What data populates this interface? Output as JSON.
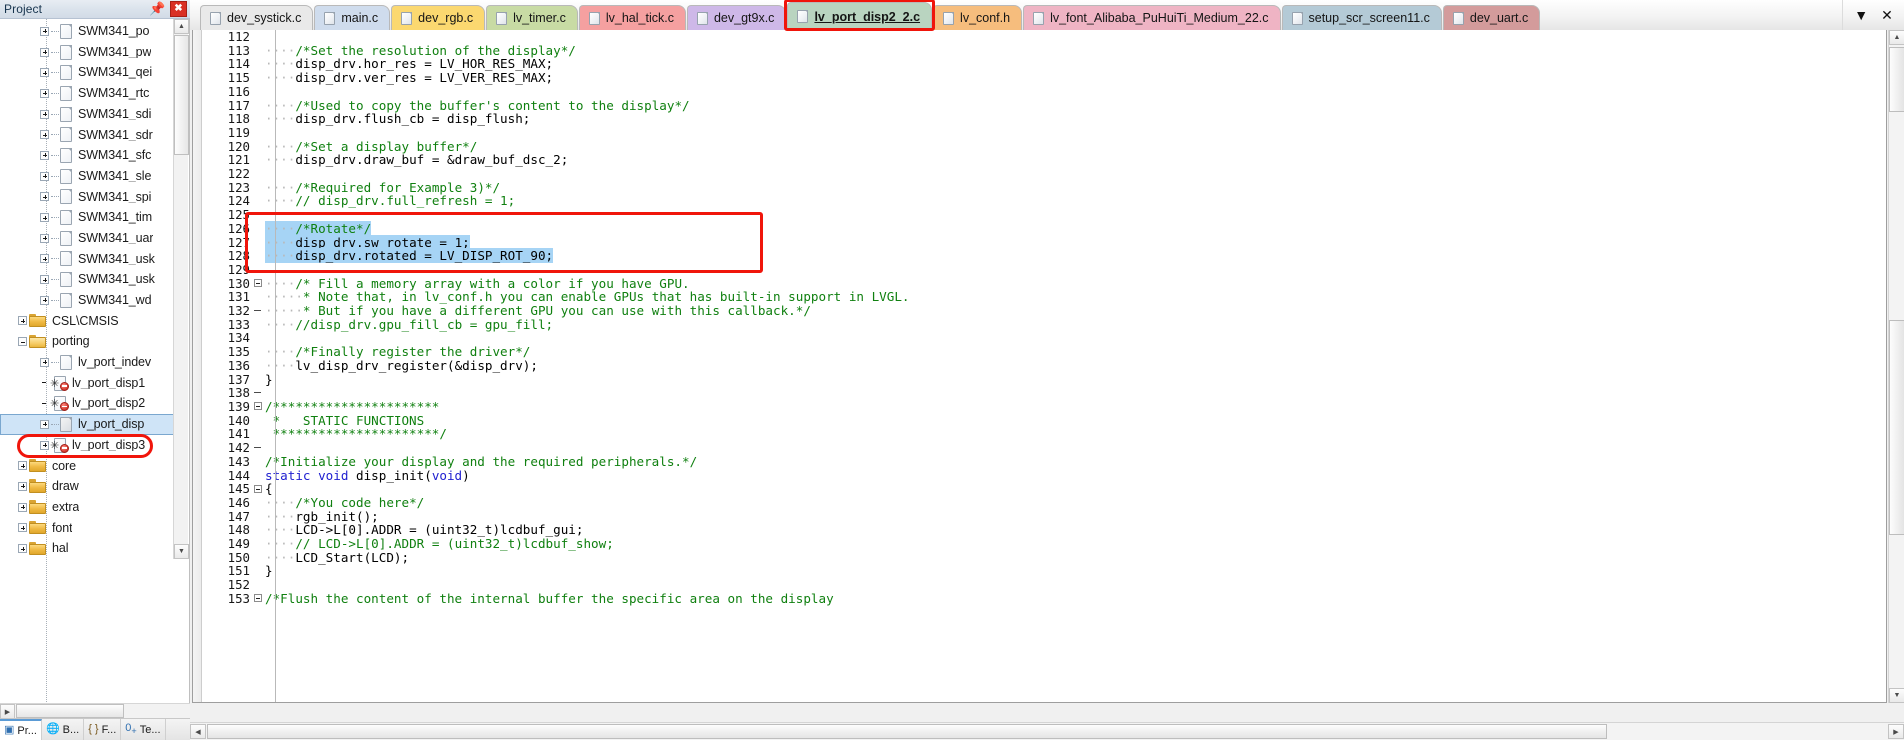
{
  "project_panel": {
    "title": "Project",
    "pin_icon": "pin-icon",
    "close_icon": "close-icon",
    "tree": [
      {
        "label": "SWM341_po",
        "icon": "file-icon",
        "indent": 3,
        "expander": "plus"
      },
      {
        "label": "SWM341_pw",
        "icon": "file-icon",
        "indent": 3,
        "expander": "plus"
      },
      {
        "label": "SWM341_qei",
        "icon": "file-icon",
        "indent": 3,
        "expander": "plus"
      },
      {
        "label": "SWM341_rtc",
        "icon": "file-icon",
        "indent": 3,
        "expander": "plus"
      },
      {
        "label": "SWM341_sdi",
        "icon": "file-icon",
        "indent": 3,
        "expander": "plus"
      },
      {
        "label": "SWM341_sdr",
        "icon": "file-icon",
        "indent": 3,
        "expander": "plus"
      },
      {
        "label": "SWM341_sfc",
        "icon": "file-icon",
        "indent": 3,
        "expander": "plus"
      },
      {
        "label": "SWM341_sle",
        "icon": "file-icon",
        "indent": 3,
        "expander": "plus"
      },
      {
        "label": "SWM341_spi",
        "icon": "file-icon",
        "indent": 3,
        "expander": "plus"
      },
      {
        "label": "SWM341_tim",
        "icon": "file-icon",
        "indent": 3,
        "expander": "plus"
      },
      {
        "label": "SWM341_uar",
        "icon": "file-icon",
        "indent": 3,
        "expander": "plus"
      },
      {
        "label": "SWM341_usk",
        "icon": "file-icon",
        "indent": 3,
        "expander": "plus"
      },
      {
        "label": "SWM341_usk",
        "icon": "file-icon",
        "indent": 3,
        "expander": "plus"
      },
      {
        "label": "SWM341_wd",
        "icon": "file-icon",
        "indent": 3,
        "expander": "plus"
      },
      {
        "label": "CSL\\CMSIS",
        "icon": "folder-icon",
        "indent": 2,
        "expander": "plus"
      },
      {
        "label": "porting",
        "icon": "folder-open-icon",
        "indent": 2,
        "expander": "minus"
      },
      {
        "label": "lv_port_indev",
        "icon": "file-icon",
        "indent": 3,
        "expander": "plus"
      },
      {
        "label": "lv_port_disp1",
        "icon": "file-excluded-icon",
        "indent": 3,
        "expander": "none"
      },
      {
        "label": "lv_port_disp2",
        "icon": "file-excluded-icon",
        "indent": 3,
        "expander": "none"
      },
      {
        "label": "lv_port_disp",
        "icon": "file-icon",
        "indent": 3,
        "expander": "plus",
        "selected": true
      },
      {
        "label": "lv_port_disp3",
        "icon": "file-excluded-icon",
        "indent": 3,
        "expander": "plus"
      },
      {
        "label": "core",
        "icon": "folder-icon",
        "indent": 2,
        "expander": "plus"
      },
      {
        "label": "draw",
        "icon": "folder-icon",
        "indent": 2,
        "expander": "plus"
      },
      {
        "label": "extra",
        "icon": "folder-icon",
        "indent": 2,
        "expander": "plus"
      },
      {
        "label": "font",
        "icon": "folder-icon",
        "indent": 2,
        "expander": "plus"
      },
      {
        "label": "hal",
        "icon": "folder-icon",
        "indent": 2,
        "expander": "plus"
      }
    ],
    "bottom_tabs": [
      {
        "label": "Pr...",
        "icon": "project-icon",
        "active": true
      },
      {
        "label": "B...",
        "icon": "books-icon",
        "active": false
      },
      {
        "label": "F...",
        "icon": "functions-icon",
        "active": false
      },
      {
        "label": "Te...",
        "icon": "templates-icon",
        "active": false
      }
    ]
  },
  "editor": {
    "tabs": [
      {
        "label": "dev_systick.c",
        "color": "#e9e9e9",
        "active": false
      },
      {
        "label": "main.c",
        "color": "#cfdced",
        "active": false
      },
      {
        "label": "dev_rgb.c",
        "color": "#fbd870",
        "active": false
      },
      {
        "label": "lv_timer.c",
        "color": "#c8dba4",
        "active": false
      },
      {
        "label": "lv_hal_tick.c",
        "color": "#f5a0a0",
        "active": false
      },
      {
        "label": "dev_gt9x.c",
        "color": "#ceb8e8",
        "active": false
      },
      {
        "label": "lv_port_disp2_2.c",
        "color": "#b9d4c0",
        "active": true
      },
      {
        "label": "lv_conf.h",
        "color": "#f6bd7d",
        "active": false
      },
      {
        "label": "lv_font_Alibaba_PuHuiTi_Medium_22.c",
        "color": "#efb4c4",
        "active": false
      },
      {
        "label": "setup_scr_screen11.c",
        "color": "#b4cad6",
        "active": false
      },
      {
        "label": "dev_uart.c",
        "color": "#d39b9b",
        "active": false
      }
    ],
    "tab_overflow_icon": "chevron-down-icon",
    "tab_close_icon": "close-icon",
    "annotation_color": "#f0150b",
    "selection_color": "#a6d4f5",
    "lines": [
      {
        "n": 112,
        "fold": "",
        "tokens": []
      },
      {
        "n": 113,
        "fold": "",
        "tokens": [
          {
            "t": "····",
            "c": "ws"
          },
          {
            "t": "/*Set the resolution of the display*/",
            "c": "cmt"
          }
        ]
      },
      {
        "n": 114,
        "fold": "",
        "tokens": [
          {
            "t": "····",
            "c": "ws"
          },
          {
            "t": "disp_drv.hor_res = LV_HOR_RES_MAX;",
            "c": "pln"
          }
        ]
      },
      {
        "n": 115,
        "fold": "",
        "tokens": [
          {
            "t": "····",
            "c": "ws"
          },
          {
            "t": "disp_drv.ver_res = LV_VER_RES_MAX;",
            "c": "pln"
          }
        ]
      },
      {
        "n": 116,
        "fold": "",
        "tokens": []
      },
      {
        "n": 117,
        "fold": "",
        "tokens": [
          {
            "t": "····",
            "c": "ws"
          },
          {
            "t": "/*Used to copy the buffer's content to the display*/",
            "c": "cmt"
          }
        ]
      },
      {
        "n": 118,
        "fold": "",
        "tokens": [
          {
            "t": "····",
            "c": "ws"
          },
          {
            "t": "disp_drv.flush_cb = disp_flush;",
            "c": "pln"
          }
        ]
      },
      {
        "n": 119,
        "fold": "",
        "tokens": []
      },
      {
        "n": 120,
        "fold": "",
        "tokens": [
          {
            "t": "····",
            "c": "ws"
          },
          {
            "t": "/*Set a display buffer*/",
            "c": "cmt"
          }
        ]
      },
      {
        "n": 121,
        "fold": "",
        "tokens": [
          {
            "t": "····",
            "c": "ws"
          },
          {
            "t": "disp_drv.draw_buf = &draw_buf_dsc_2;",
            "c": "pln"
          }
        ]
      },
      {
        "n": 122,
        "fold": "",
        "tokens": []
      },
      {
        "n": 123,
        "fold": "",
        "tokens": [
          {
            "t": "····",
            "c": "ws"
          },
          {
            "t": "/*Required for Example 3)*/",
            "c": "cmt"
          }
        ]
      },
      {
        "n": 124,
        "fold": "",
        "tokens": [
          {
            "t": "····",
            "c": "ws"
          },
          {
            "t": "// disp_drv.full_refresh = 1;",
            "c": "cmt"
          }
        ]
      },
      {
        "n": 125,
        "fold": "",
        "tokens": []
      },
      {
        "n": 126,
        "fold": "",
        "sel": true,
        "tokens": [
          {
            "t": "····",
            "c": "ws sel"
          },
          {
            "t": "/*Rotate*/",
            "c": "cmt sel"
          }
        ]
      },
      {
        "n": 127,
        "fold": "",
        "sel": true,
        "tokens": [
          {
            "t": "····",
            "c": "ws sel"
          },
          {
            "t": "disp_drv.sw_rotate = 1;",
            "c": "pln sel"
          }
        ]
      },
      {
        "n": 128,
        "fold": "",
        "sel": true,
        "tokens": [
          {
            "t": "····",
            "c": "ws sel"
          },
          {
            "t": "disp_drv.rotated = LV_DISP_ROT_90;",
            "c": "pln sel"
          }
        ]
      },
      {
        "n": 129,
        "fold": "",
        "tokens": []
      },
      {
        "n": 130,
        "fold": "box",
        "tokens": [
          {
            "t": "····",
            "c": "ws"
          },
          {
            "t": "/* Fill a memory array with a color if you have GPU.",
            "c": "cmt"
          }
        ]
      },
      {
        "n": 131,
        "fold": "",
        "tokens": [
          {
            "t": "·····",
            "c": "ws"
          },
          {
            "t": "* Note that, in lv_conf.h you can enable GPUs that has built-in support in LVGL.",
            "c": "cmt"
          }
        ]
      },
      {
        "n": 132,
        "fold": "bar",
        "tokens": [
          {
            "t": "·····",
            "c": "ws"
          },
          {
            "t": "* But if you have a different GPU you can use with this callback.*/",
            "c": "cmt"
          }
        ]
      },
      {
        "n": 133,
        "fold": "",
        "tokens": [
          {
            "t": "····",
            "c": "ws"
          },
          {
            "t": "//disp_drv.gpu_fill_cb = gpu_fill;",
            "c": "cmt"
          }
        ]
      },
      {
        "n": 134,
        "fold": "",
        "tokens": []
      },
      {
        "n": 135,
        "fold": "",
        "tokens": [
          {
            "t": "····",
            "c": "ws"
          },
          {
            "t": "/*Finally register the driver*/",
            "c": "cmt"
          }
        ]
      },
      {
        "n": 136,
        "fold": "",
        "tokens": [
          {
            "t": "····",
            "c": "ws"
          },
          {
            "t": "lv_disp_drv_register(&disp_drv);",
            "c": "pln"
          }
        ]
      },
      {
        "n": 137,
        "fold": "",
        "tokens": [
          {
            "t": "}",
            "c": "pln"
          }
        ]
      },
      {
        "n": 138,
        "fold": "bar",
        "tokens": []
      },
      {
        "n": 139,
        "fold": "box",
        "tokens": [
          {
            "t": "/**********************",
            "c": "cmt"
          }
        ]
      },
      {
        "n": 140,
        "fold": "",
        "tokens": [
          {
            "t": " *   STATIC FUNCTIONS",
            "c": "cmt"
          }
        ]
      },
      {
        "n": 141,
        "fold": "",
        "tokens": [
          {
            "t": " **********************/",
            "c": "cmt"
          }
        ]
      },
      {
        "n": 142,
        "fold": "bar",
        "tokens": []
      },
      {
        "n": 143,
        "fold": "",
        "tokens": [
          {
            "t": "/*Initialize your display and the required peripherals.*/",
            "c": "cmt"
          }
        ]
      },
      {
        "n": 144,
        "fold": "",
        "tokens": [
          {
            "t": "static void",
            "c": "kw"
          },
          {
            "t": " disp_init(",
            "c": "pln"
          },
          {
            "t": "void",
            "c": "kw"
          },
          {
            "t": ")",
            "c": "pln"
          }
        ]
      },
      {
        "n": 145,
        "fold": "box",
        "tokens": [
          {
            "t": "{",
            "c": "pln"
          }
        ]
      },
      {
        "n": 146,
        "fold": "",
        "tokens": [
          {
            "t": "····",
            "c": "ws"
          },
          {
            "t": "/*You code here*/",
            "c": "cmt"
          }
        ]
      },
      {
        "n": 147,
        "fold": "",
        "tokens": [
          {
            "t": "····",
            "c": "ws"
          },
          {
            "t": "rgb_init();",
            "c": "pln"
          }
        ]
      },
      {
        "n": 148,
        "fold": "",
        "tokens": [
          {
            "t": "····",
            "c": "ws"
          },
          {
            "t": "LCD->L[0].ADDR = (uint32_t)lcdbuf_gui;",
            "c": "pln"
          }
        ]
      },
      {
        "n": 149,
        "fold": "",
        "tokens": [
          {
            "t": "····",
            "c": "ws"
          },
          {
            "t": "// LCD->L[0].ADDR = (uint32_t)lcdbuf_show;",
            "c": "cmt"
          }
        ]
      },
      {
        "n": 150,
        "fold": "",
        "tokens": [
          {
            "t": "····",
            "c": "ws"
          },
          {
            "t": "LCD_Start(LCD);",
            "c": "pln"
          }
        ]
      },
      {
        "n": 151,
        "fold": "",
        "tokens": [
          {
            "t": "}",
            "c": "pln"
          }
        ]
      },
      {
        "n": 152,
        "fold": "",
        "tokens": []
      },
      {
        "n": 153,
        "fold": "box",
        "tokens": [
          {
            "t": "/*Flush the content of the internal buffer the specific area on the display",
            "c": "cmt"
          }
        ]
      }
    ]
  }
}
